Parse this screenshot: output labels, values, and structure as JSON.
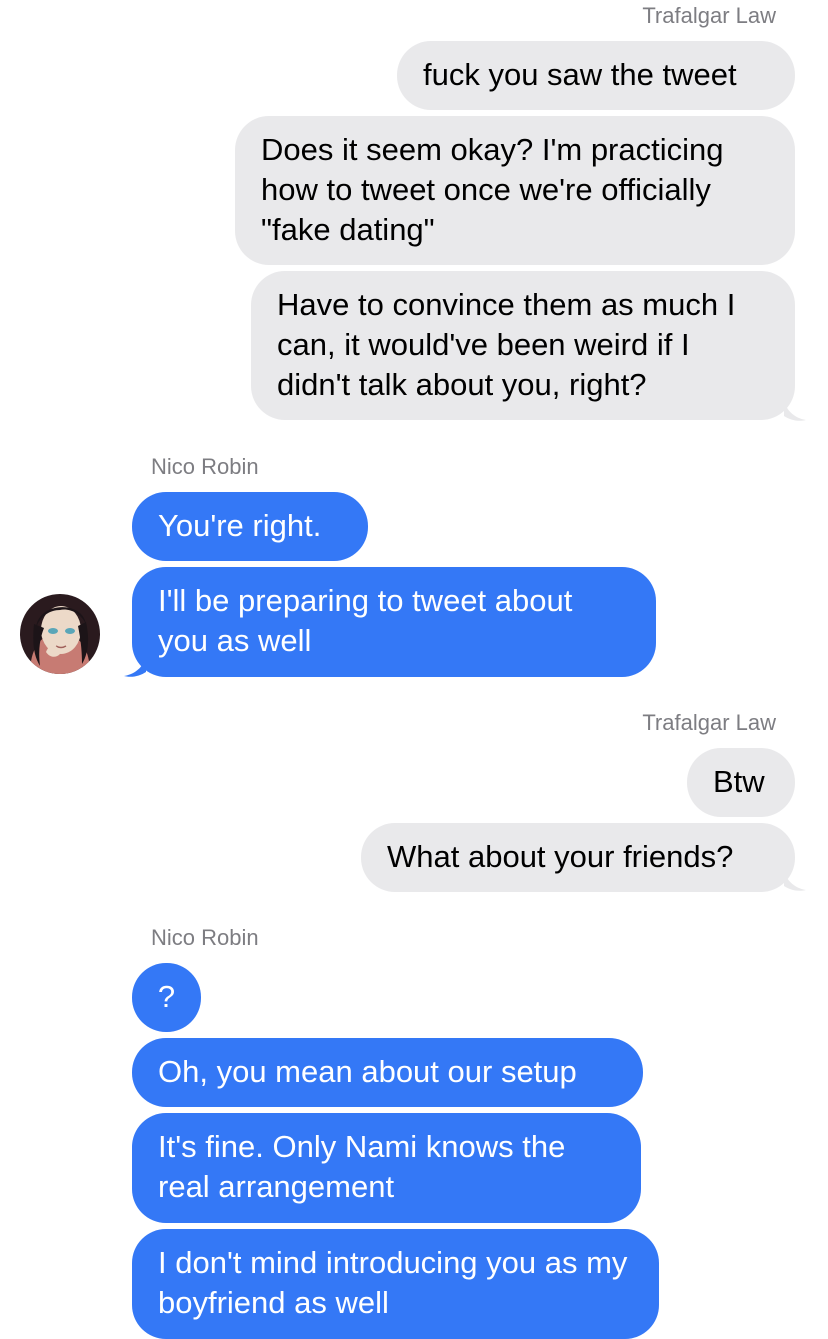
{
  "conversation": {
    "group1_sender": "Trafalgar Law",
    "group1_messages": [
      "fuck you saw the tweet",
      "Does it seem okay? I'm practicing how to tweet once we're officially \"fake dating\"",
      "Have to convince them as much I can, it would've been weird if I didn't talk about you, right?"
    ],
    "group2_sender": "Nico Robin",
    "group2_messages": [
      "You're right.",
      "I'll be preparing to tweet about you as well"
    ],
    "group3_sender": "Trafalgar Law",
    "group3_messages": [
      "Btw",
      "What about your friends?"
    ],
    "group4_sender": "Nico Robin",
    "group4_messages": [
      "?",
      "Oh, you mean about our setup",
      "It's fine. Only Nami knows the real arrangement",
      "I don't mind introducing you as my boyfriend as well"
    ]
  },
  "colors": {
    "outgoing_bubble": "#e9e9eb",
    "incoming_bubble": "#3478f6",
    "sender_label": "#7d7d82"
  },
  "icons": {
    "avatar": "contact-avatar-nico-robin"
  }
}
